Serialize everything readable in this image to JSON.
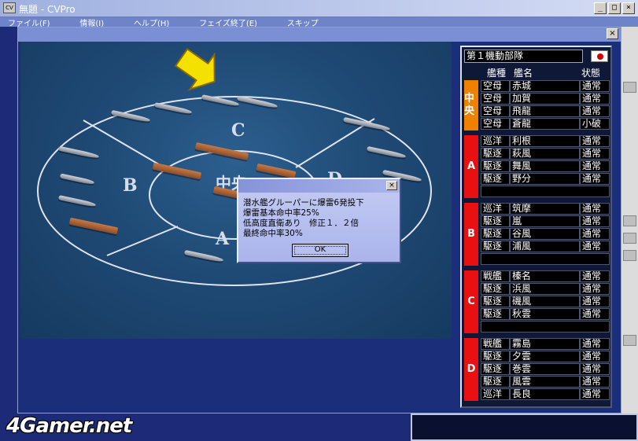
{
  "app": {
    "title": "無題 - CVPro",
    "icon_label": "CV",
    "minimize": "_",
    "maximize": "□",
    "close": "×",
    "menu": [
      "ファイル(F)",
      "情報(I)",
      "ヘルプ(H)",
      "フェイズ終了(E)",
      "スキップ"
    ]
  },
  "inner_window": {
    "close": "×"
  },
  "battlefield": {
    "zones": {
      "c": "C",
      "b": "B",
      "a": "A",
      "d": "D",
      "center": "中央"
    }
  },
  "message_dialog": {
    "close": "×",
    "lines": [
      "潜水艦グルーパーに爆雷6発投下",
      "爆雷基本命中率25%",
      "低高度直衛あり　修正１．２倍",
      "最終命中率30%"
    ],
    "ok_label": "OK"
  },
  "fleet_panel": {
    "fleet_name": "第１機動部隊",
    "flag_icon": "japan-flag-icon",
    "headers": {
      "type": "艦種",
      "name": "艦名",
      "status": "状態"
    },
    "groups": [
      {
        "label": "中央",
        "color": "#f08000",
        "ships": [
          {
            "type": "空母",
            "name": "赤城",
            "status": "通常"
          },
          {
            "type": "空母",
            "name": "加賀",
            "status": "通常"
          },
          {
            "type": "空母",
            "name": "飛龍",
            "status": "通常"
          },
          {
            "type": "空母",
            "name": "蒼龍",
            "status": "小破"
          }
        ]
      },
      {
        "label": "A",
        "color": "#e81010",
        "ships": [
          {
            "type": "巡洋",
            "name": "利根",
            "status": "通常"
          },
          {
            "type": "駆逐",
            "name": "萩風",
            "status": "通常"
          },
          {
            "type": "駆逐",
            "name": "舞風",
            "status": "通常"
          },
          {
            "type": "駆逐",
            "name": "野分",
            "status": "通常"
          }
        ]
      },
      {
        "label": "B",
        "color": "#e81010",
        "ships": [
          {
            "type": "巡洋",
            "name": "筑摩",
            "status": "通常"
          },
          {
            "type": "駆逐",
            "name": "嵐",
            "status": "通常"
          },
          {
            "type": "駆逐",
            "name": "谷風",
            "status": "通常"
          },
          {
            "type": "駆逐",
            "name": "浦風",
            "status": "通常"
          }
        ]
      },
      {
        "label": "C",
        "color": "#e81010",
        "ships": [
          {
            "type": "戦艦",
            "name": "榛名",
            "status": "通常"
          },
          {
            "type": "駆逐",
            "name": "浜風",
            "status": "通常"
          },
          {
            "type": "駆逐",
            "name": "磯風",
            "status": "通常"
          },
          {
            "type": "駆逐",
            "name": "秋雲",
            "status": "通常"
          }
        ]
      },
      {
        "label": "D",
        "color": "#e81010",
        "ships": [
          {
            "type": "戦艦",
            "name": "霧島",
            "status": "通常"
          },
          {
            "type": "駆逐",
            "name": "夕雲",
            "status": "通常"
          },
          {
            "type": "駆逐",
            "name": "巻雲",
            "status": "通常"
          },
          {
            "type": "駆逐",
            "name": "風雲",
            "status": "通常"
          },
          {
            "type": "巡洋",
            "name": "長良",
            "status": "通常"
          }
        ]
      }
    ]
  },
  "watermark": "4Gamer.net"
}
